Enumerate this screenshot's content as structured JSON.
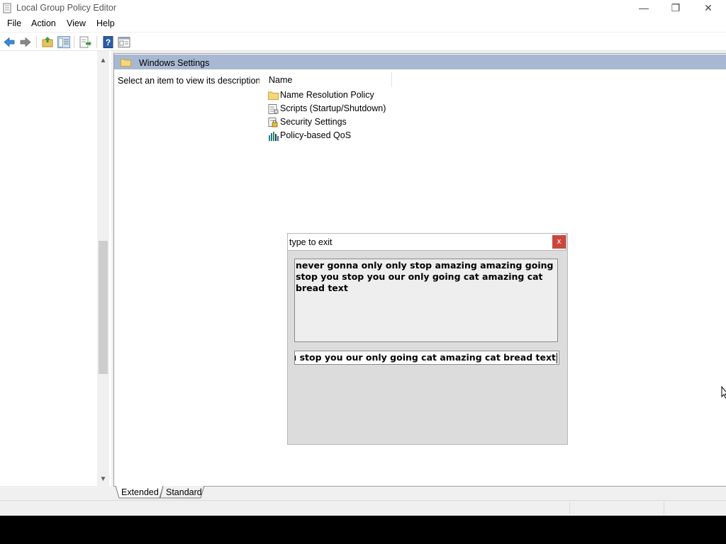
{
  "window": {
    "title": "Local Group Policy Editor",
    "controls": {
      "minimize": "—",
      "maximize": "❐",
      "close": "✕"
    }
  },
  "menu": [
    "File",
    "Action",
    "View",
    "Help"
  ],
  "toolbar": {
    "icons": [
      "back-arrow-icon",
      "forward-arrow-icon",
      "up-folder-icon",
      "show-hide-tree-icon",
      "export-list-icon",
      "help-icon",
      "properties-icon"
    ]
  },
  "tree": {
    "scroll_up": "▲",
    "scroll_down": "▼"
  },
  "details": {
    "header_title": "Windows Settings",
    "description": "Select an item to view its description.",
    "column_name": "Name",
    "items": [
      {
        "label": "Name Resolution Policy",
        "icon": "folder-icon"
      },
      {
        "label": "Scripts (Startup/Shutdown)",
        "icon": "scripts-icon"
      },
      {
        "label": "Security Settings",
        "icon": "security-settings-icon"
      },
      {
        "label": "Policy-based QoS",
        "icon": "qos-chart-icon"
      }
    ]
  },
  "tabs": [
    "Extended",
    "Standard"
  ],
  "popup": {
    "title": "type to exit",
    "close_label": "x",
    "textarea_text": "never gonna only only stop amazing amazing going stop you stop you our only going cat amazing cat bread text",
    "input_value": "ip you stop you our only going cat amazing cat bread text"
  },
  "colors": {
    "header_strip": "#a7b8d2",
    "popup_close": "#c9473e"
  }
}
